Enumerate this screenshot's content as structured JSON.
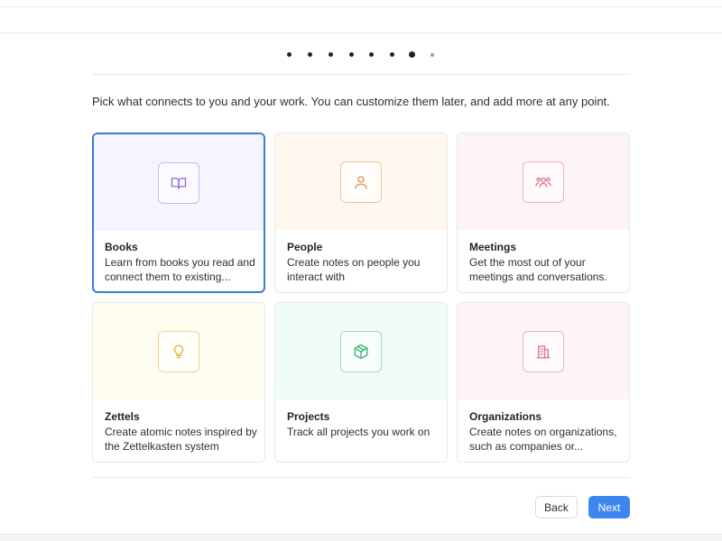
{
  "stepper": {
    "total_steps": 8,
    "current_step": 7
  },
  "intro_text": "Pick what connects to you and your work. You can customize them later, and add more at any point.",
  "cards": [
    {
      "title": "Books",
      "description": "Learn from books you read and connect them to existing...",
      "icon": "book-icon",
      "accent": "#8f6bd6",
      "tint": "#f6f4fe",
      "selected": true
    },
    {
      "title": "People",
      "description": "Create notes on people you interact with",
      "icon": "person-icon",
      "accent": "#e39055",
      "tint": "#fff8f1",
      "selected": false
    },
    {
      "title": "Meetings",
      "description": "Get the most out of your meetings and conversations.",
      "icon": "group-icon",
      "accent": "#e0707f",
      "tint": "#fdf4f5",
      "selected": false
    },
    {
      "title": "Zettels",
      "description": "Create atomic notes inspired by the Zettelkasten system",
      "icon": "lightbulb-icon",
      "accent": "#e6ae3c",
      "tint": "#fffcf0",
      "selected": false
    },
    {
      "title": "Projects",
      "description": "Track all projects you work on",
      "icon": "cube-icon",
      "accent": "#43b27c",
      "tint": "#f1fbf6",
      "selected": false
    },
    {
      "title": "Organizations",
      "description": "Create notes on organizations, such as companies or...",
      "icon": "building-icon",
      "accent": "#e0707f",
      "tint": "#fdf4f5",
      "selected": false
    }
  ],
  "buttons": {
    "back_label": "Back",
    "next_label": "Next"
  },
  "colors": {
    "primary": "#3d86f0",
    "selected_border": "#3f78d6"
  }
}
